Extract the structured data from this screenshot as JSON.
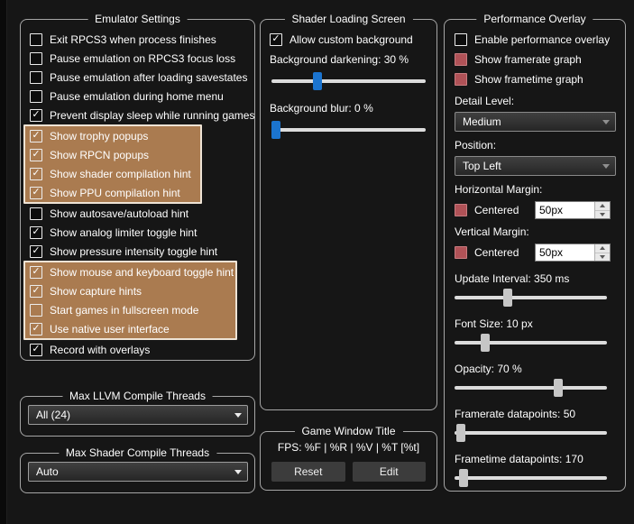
{
  "colors": {
    "accent_blue": "#1b74cf",
    "highlight_brown": "#aa7b50",
    "disabled_red": "#b05257"
  },
  "emulator_settings": {
    "title": "Emulator Settings",
    "segments": [
      {
        "highlight": false,
        "items": [
          {
            "label": "Exit RPCS3 when process finishes",
            "checked": false
          },
          {
            "label": "Pause emulation on RPCS3 focus loss",
            "checked": false
          },
          {
            "label": "Pause emulation after loading savestates",
            "checked": false
          },
          {
            "label": "Pause emulation during home menu",
            "checked": false
          },
          {
            "label": "Prevent display sleep while running games",
            "checked": true
          }
        ]
      },
      {
        "highlight": true,
        "items": [
          {
            "label": "Show trophy popups",
            "checked": true
          },
          {
            "label": "Show RPCN popups",
            "checked": true
          },
          {
            "label": "Show shader compilation hint",
            "checked": true
          },
          {
            "label": "Show PPU compilation hint",
            "checked": true
          }
        ]
      },
      {
        "highlight": false,
        "items": [
          {
            "label": "Show autosave/autoload hint",
            "checked": false
          },
          {
            "label": "Show analog limiter toggle hint",
            "checked": true
          },
          {
            "label": "Show pressure intensity toggle hint",
            "checked": true
          }
        ]
      },
      {
        "highlight": true,
        "items": [
          {
            "label": "Show mouse and keyboard toggle hint",
            "checked": true
          },
          {
            "label": "Show capture hints",
            "checked": true
          },
          {
            "label": "Start games in fullscreen mode",
            "checked": false
          },
          {
            "label": "Use native user interface",
            "checked": true
          }
        ]
      },
      {
        "highlight": false,
        "items": [
          {
            "label": "Record with overlays",
            "checked": true
          }
        ]
      }
    ]
  },
  "max_llvm_threads": {
    "title": "Max LLVM Compile Threads",
    "value": "All (24)"
  },
  "max_shader_threads": {
    "title": "Max Shader Compile Threads",
    "value": "Auto"
  },
  "shader_loading": {
    "title": "Shader Loading Screen",
    "allow_custom_background": {
      "label": "Allow custom background",
      "checked": true
    },
    "darkening": {
      "label": "Background darkening: 30 %",
      "percent": 30
    },
    "blur": {
      "label": "Background blur: 0 %",
      "percent": 0
    }
  },
  "game_window_title": {
    "title": "Game Window Title",
    "format": "FPS: %F | %R | %V | %T [%t]",
    "reset_label": "Reset",
    "edit_label": "Edit"
  },
  "performance_overlay": {
    "title": "Performance Overlay",
    "checkboxes": [
      {
        "label": "Enable performance overlay",
        "checked": false,
        "style": "normal"
      },
      {
        "label": "Show framerate graph",
        "checked": false,
        "style": "red"
      },
      {
        "label": "Show frametime graph",
        "checked": false,
        "style": "red"
      }
    ],
    "detail_level": {
      "label": "Detail Level:",
      "value": "Medium"
    },
    "position": {
      "label": "Position:",
      "value": "Top Left"
    },
    "horizontal_margin": {
      "label": "Horizontal Margin:",
      "centered_label": "Centered",
      "value": "50px"
    },
    "vertical_margin": {
      "label": "Vertical Margin:",
      "centered_label": "Centered",
      "value": "50px"
    },
    "sliders": [
      {
        "name": "update-interval-slider",
        "label": "Update Interval: 350 ms",
        "percent": 35
      },
      {
        "name": "font-size-slider",
        "label": "Font Size: 10 px",
        "percent": 20
      },
      {
        "name": "opacity-slider",
        "label": "Opacity: 70 %",
        "percent": 68
      },
      {
        "name": "framerate-datapoints-slider",
        "label": "Framerate datapoints: 50",
        "percent": 4
      },
      {
        "name": "frametime-datapoints-slider",
        "label": "Frametime datapoints: 170",
        "percent": 6
      }
    ]
  }
}
